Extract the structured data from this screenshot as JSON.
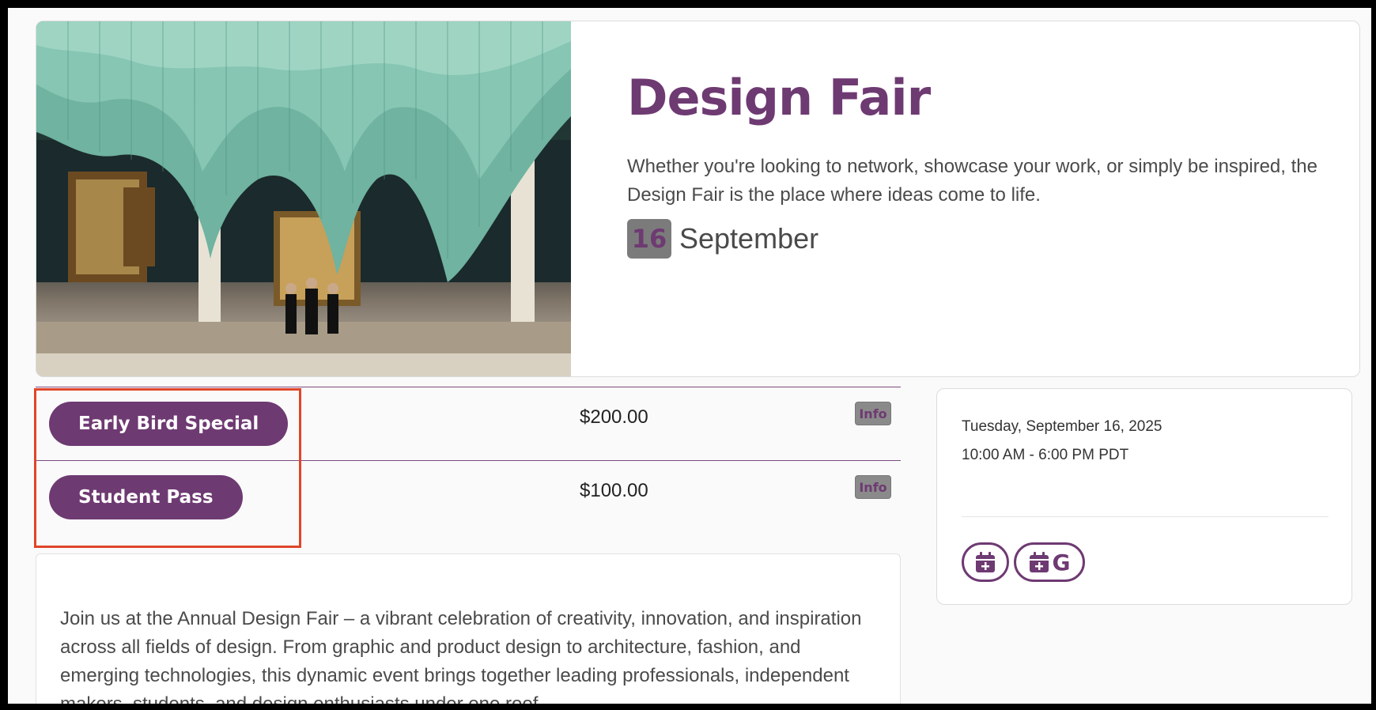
{
  "event": {
    "title": "Design Fair",
    "description": "Whether you're looking to network, showcase your work, or simply be inspired, the Design Fair is the place where ideas come to life.",
    "date_day": "16",
    "date_month": "September",
    "image_alt": "Gallery hall with green sculptural ceiling installation"
  },
  "tickets": [
    {
      "label": "Early Bird Special",
      "price": "$200.00",
      "info_label": "Info"
    },
    {
      "label": "Student Pass",
      "price": "$100.00",
      "info_label": "Info"
    }
  ],
  "about": {
    "text": "Join us at the Annual Design Fair – a vibrant celebration of creativity, innovation, and inspiration across all fields of design. From graphic and product design to architecture, fashion, and emerging technologies, this dynamic event brings together leading professionals, independent makers, students, and design enthusiasts under one roof."
  },
  "sidebar": {
    "date": "Tuesday, September 16, 2025",
    "time": "10:00 AM - 6:00 PM PDT",
    "calendar_buttons": [
      {
        "icon": "calendar-plus-icon"
      },
      {
        "icon": "google-calendar-icon",
        "letter": "G"
      }
    ]
  },
  "colors": {
    "brand_purple": "#6e3a72",
    "highlight": "#e0452a",
    "date_badge": "#7b7b7b"
  }
}
